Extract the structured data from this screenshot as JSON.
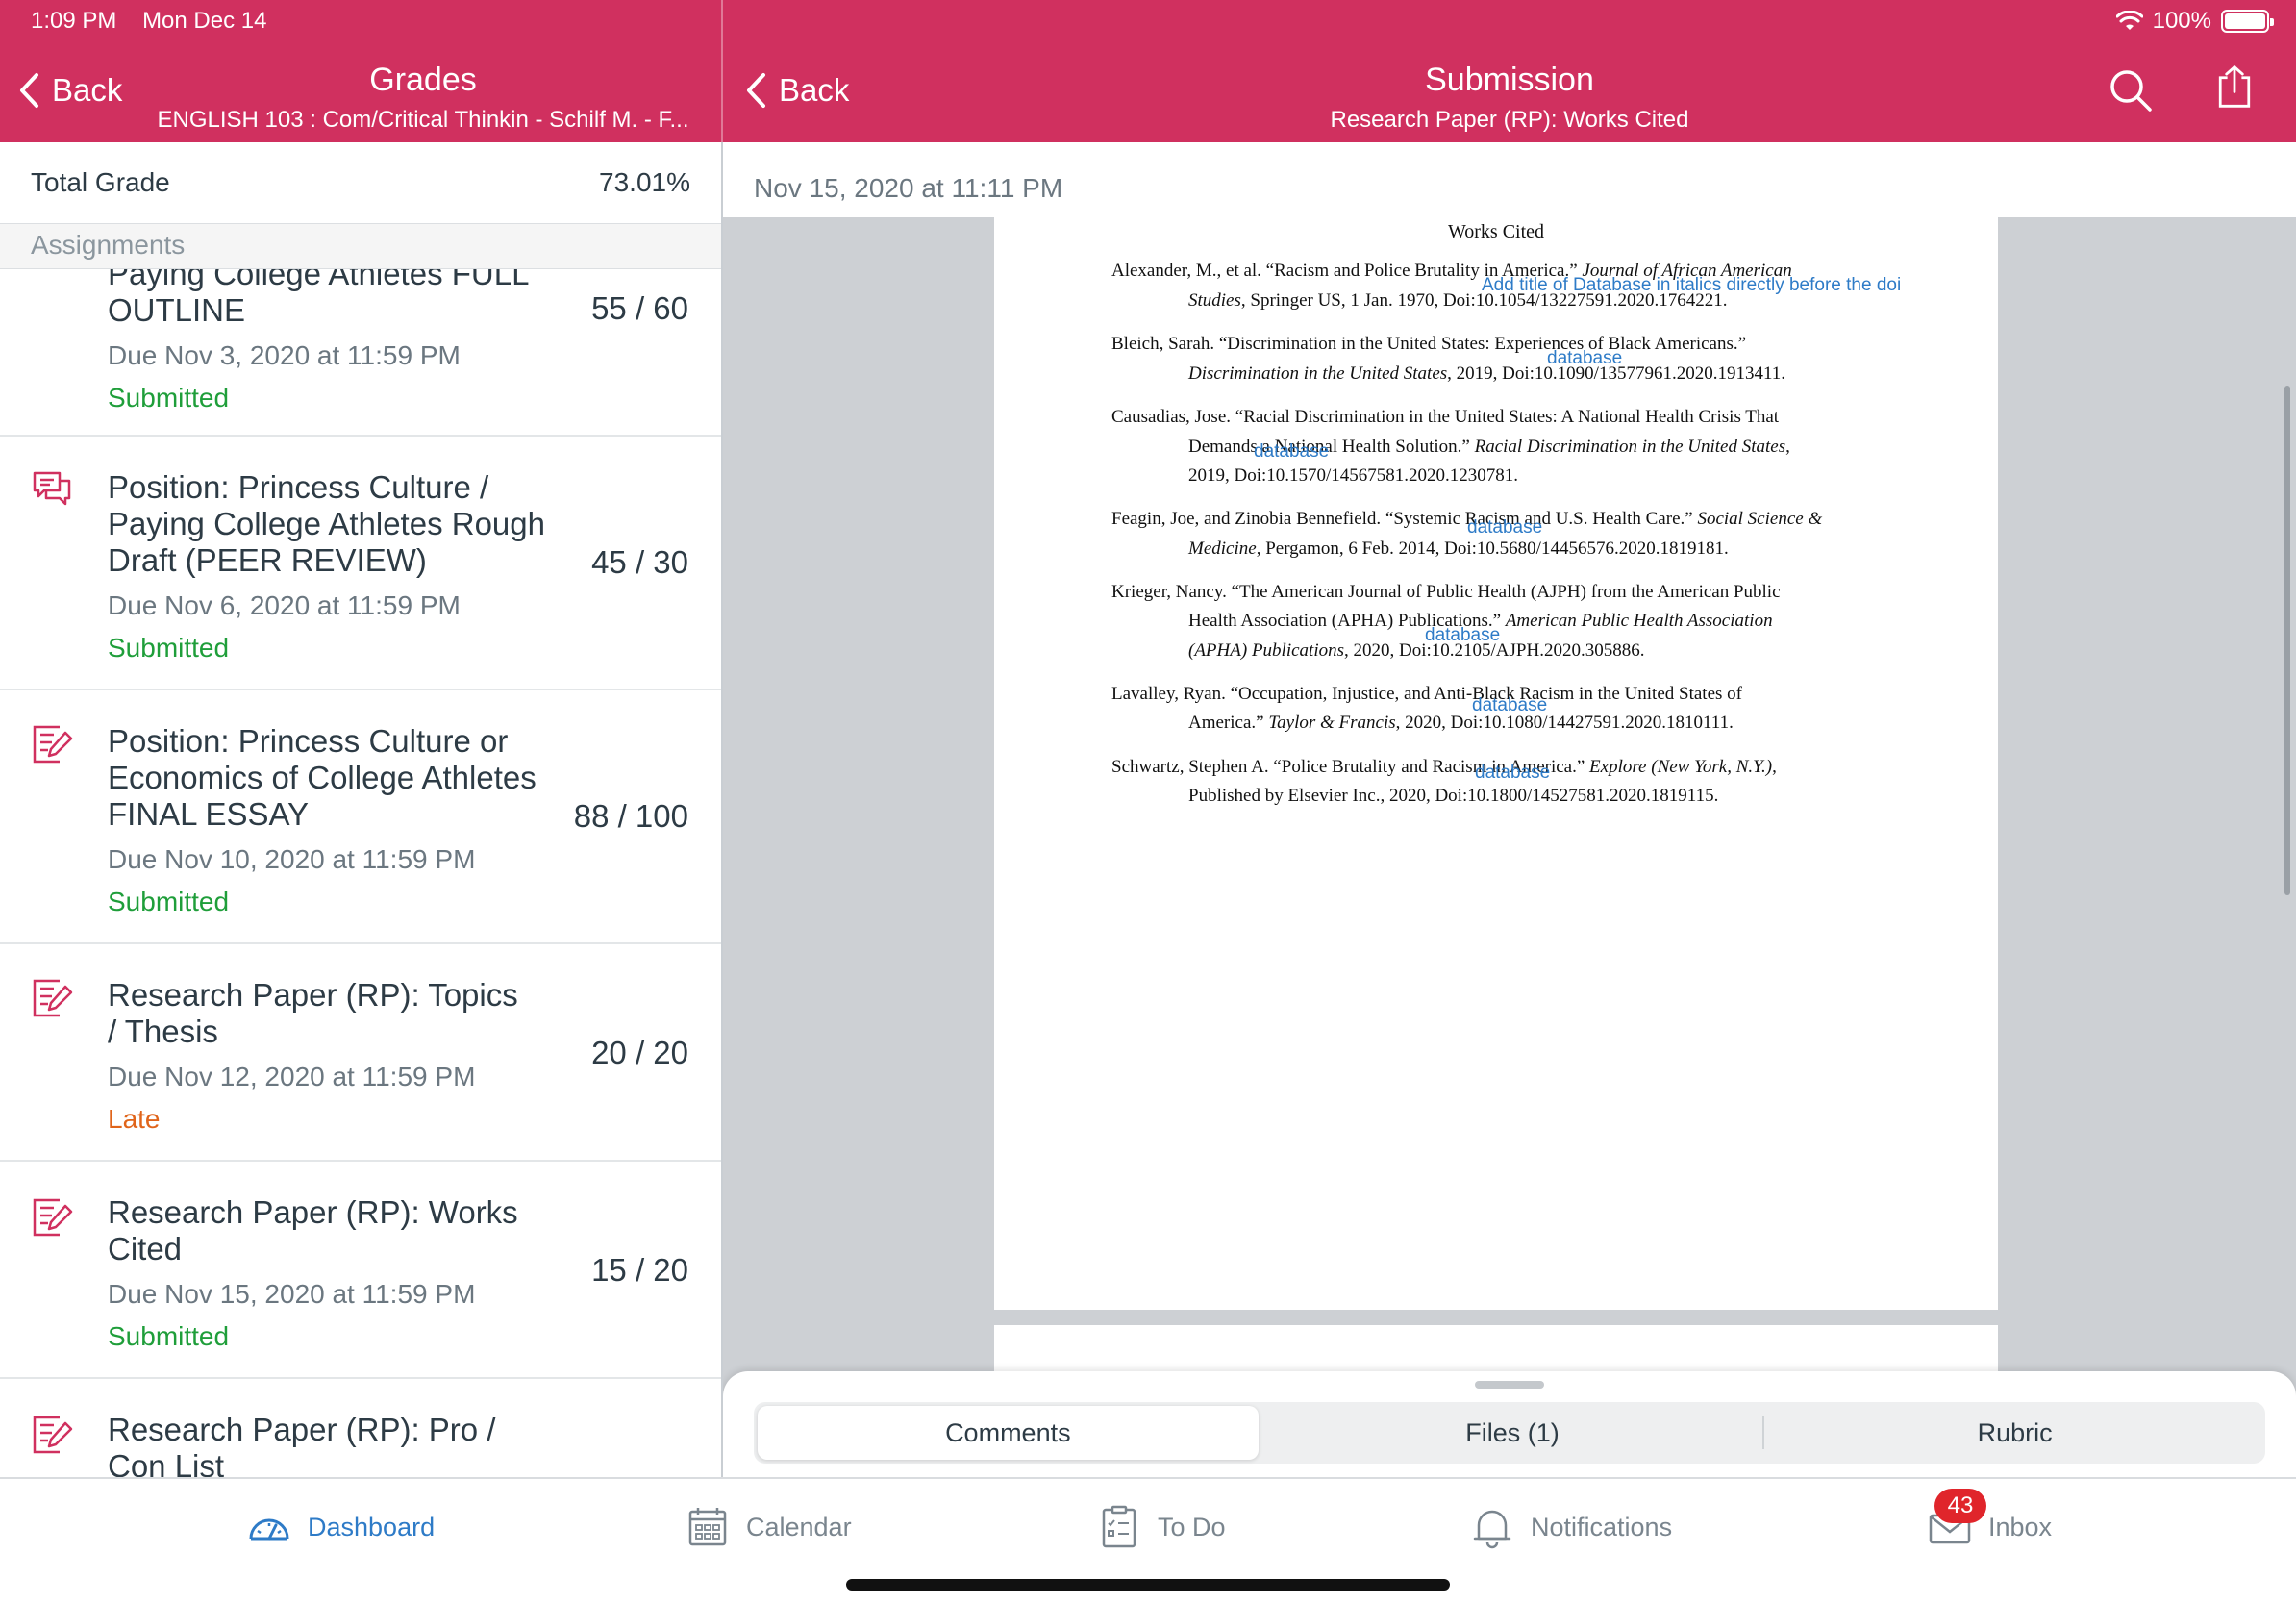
{
  "status_bar": {
    "time": "1:09 PM",
    "date": "Mon Dec 14",
    "battery": "100%"
  },
  "left_nav": {
    "back_label": "Back",
    "title": "Grades",
    "subtitle": "ENGLISH 103 : Com/Critical Thinkin - Schilf M. - F..."
  },
  "right_nav": {
    "back_label": "Back",
    "title": "Submission",
    "subtitle": "Research Paper (RP): Works Cited"
  },
  "grades": {
    "total_label": "Total Grade",
    "total_value": "73.01%",
    "section_label": "Assignments",
    "items": [
      {
        "title": "Paying College Athletes FULL OUTLINE",
        "due": "Due Nov 3, 2020 at 11:59 PM",
        "status": "Submitted",
        "score": "55 / 60",
        "icon": "assignment-icon"
      },
      {
        "title": "Position: Princess Culture / Paying College Athletes Rough Draft (PEER REVIEW)",
        "due": "Due Nov 6, 2020 at 11:59 PM",
        "status": "Submitted",
        "score": "45 / 30",
        "icon": "discussion-icon"
      },
      {
        "title": "Position: Princess Culture or Economics of College Athletes FINAL ESSAY",
        "due": "Due Nov 10, 2020 at 11:59 PM",
        "status": "Submitted",
        "score": "88 / 100",
        "icon": "assignment-icon"
      },
      {
        "title": "Research Paper (RP): Topics / Thesis",
        "due": "Due Nov 12, 2020 at 11:59 PM",
        "status": "Late",
        "score": "20 / 20",
        "icon": "assignment-icon"
      },
      {
        "title": "Research Paper (RP): Works Cited",
        "due": "Due Nov 15, 2020 at 11:59 PM",
        "status": "Submitted",
        "score": "15 / 20",
        "icon": "assignment-icon"
      },
      {
        "title": "Research Paper (RP): Pro / Con List",
        "due": "",
        "status": "",
        "score": "",
        "icon": "assignment-icon"
      }
    ]
  },
  "submission": {
    "date": "Nov 15, 2020 at 11:11 PM",
    "doc_heading": "Works Cited",
    "lines": [
      {
        "pre": "Alexander, M., et al. “Racism and Police Brutality in America.” ",
        "ital": "Journal of African American",
        "post": ""
      },
      {
        "pre": "",
        "ital": "Studies",
        "post": ", Springer US, 1 Jan. 1970, Doi:10.1054/13227591.2020.1764221."
      },
      {
        "pre": "Bleich, Sarah. “Discrimination in the United States: Experiences of Black Americans.”",
        "ital": "",
        "post": ""
      },
      {
        "pre": "",
        "ital": "Discrimination in the United States",
        "post": ", 2019, Doi:10.1090/13577961.2020.1913411."
      },
      {
        "pre": "Causadias, Jose. “Racial Discrimination in the United States: A National Health Crisis That",
        "ital": "",
        "post": ""
      },
      {
        "pre": "Demands a National Health Solution.” ",
        "ital": "Racial Discrimination in the United States",
        "post": ","
      },
      {
        "pre": "2019, Doi:10.1570/14567581.2020.1230781.",
        "ital": "",
        "post": ""
      },
      {
        "pre": "Feagin, Joe, and Zinobia Bennefield. “Systemic Racism and U.S. Health Care.” ",
        "ital": "Social Science &",
        "post": ""
      },
      {
        "pre": "",
        "ital": "Medicine",
        "post": ", Pergamon, 6 Feb. 2014, Doi:10.5680/14456576.2020.1819181."
      },
      {
        "pre": "Krieger, Nancy. “The American Journal of Public Health (AJPH) from the American Public",
        "ital": "",
        "post": ""
      },
      {
        "pre": "Health Association (APHA) Publications.” ",
        "ital": "American Public Health Association",
        "post": ""
      },
      {
        "pre": "",
        "ital": "(APHA) Publications",
        "post": ", 2020, Doi:10.2105/AJPH.2020.305886."
      },
      {
        "pre": "Lavalley, Ryan. “Occupation, Injustice, and Anti-Black Racism in the United States of",
        "ital": "",
        "post": ""
      },
      {
        "pre": "America.” ",
        "ital": "Taylor & Francis",
        "post": ", 2020, Doi:10.1080/14427591.2020.1810111."
      },
      {
        "pre": "Schwartz, Stephen A. “Police Brutality and Racism in America.” ",
        "ital": "Explore (New York, N.Y.)",
        "post": ","
      },
      {
        "pre": "Published by Elsevier Inc., 2020, Doi:10.1800/14527581.2020.1819115.",
        "ital": "",
        "post": ""
      }
    ],
    "annotations": [
      "Add title of Database in italics directly before the doi",
      "database",
      "database",
      "database",
      "database",
      "database",
      "database"
    ],
    "tabs": [
      "Comments",
      "Files (1)",
      "Rubric"
    ]
  },
  "tabbar": {
    "items": [
      "Dashboard",
      "Calendar",
      "To Do",
      "Notifications",
      "Inbox"
    ],
    "inbox_badge": "43"
  },
  "colors": {
    "brand": "#d0305f",
    "submitted": "#1f9e3a",
    "late": "#e0641a",
    "annotation": "#2e7bc7",
    "active_tab": "#2e7bc7"
  }
}
